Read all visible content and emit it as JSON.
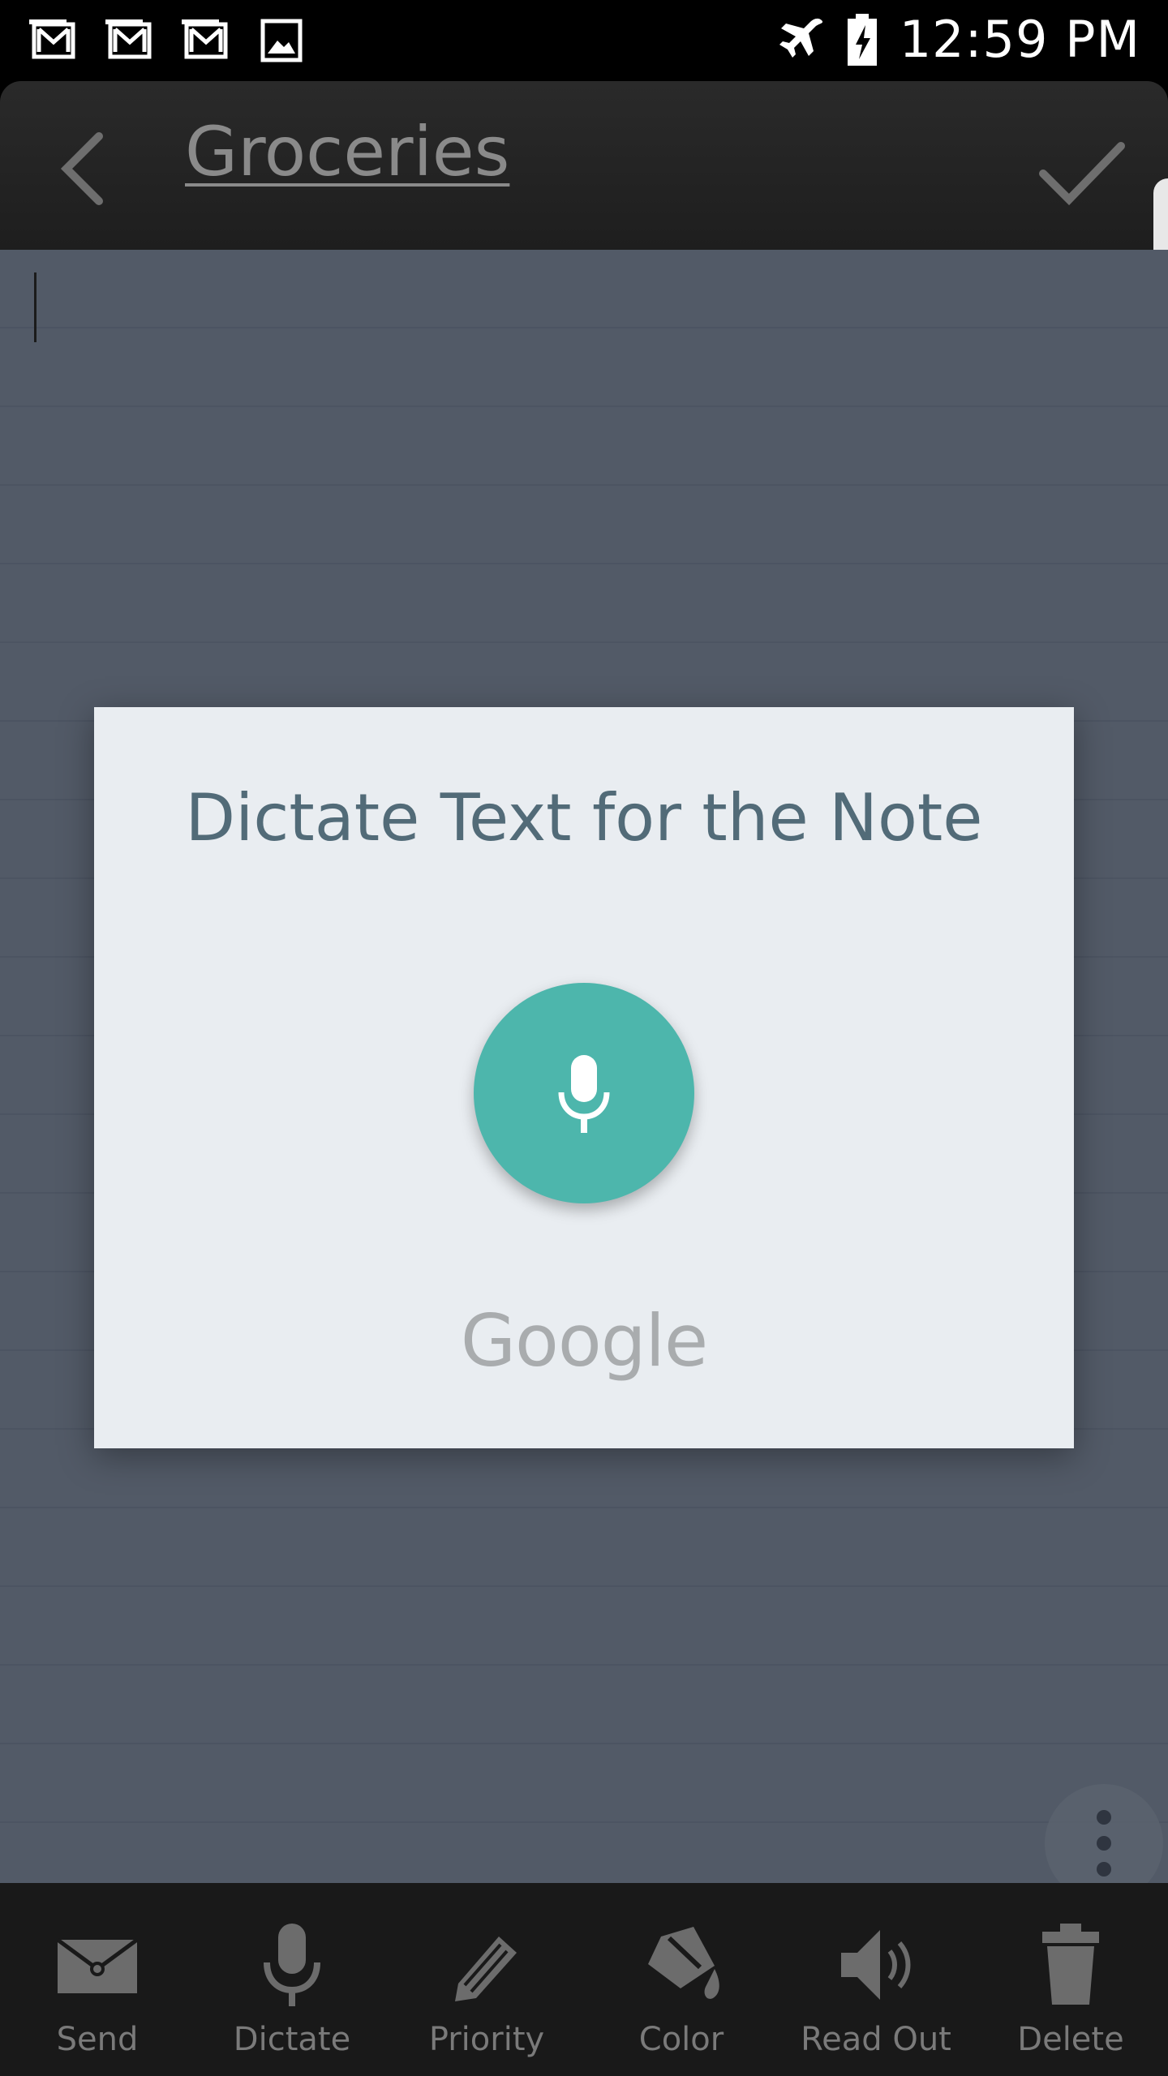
{
  "status_bar": {
    "time": "12:59 PM",
    "left_icons": [
      "gmail-icon",
      "gmail-icon",
      "gmail-icon",
      "gallery-icon"
    ],
    "right_icons": [
      "airplane-mode-icon",
      "battery-charging-icon"
    ]
  },
  "app_bar": {
    "title": "Groceries",
    "back_icon": "chevron-left-icon",
    "confirm_icon": "checkmark-icon"
  },
  "dialog": {
    "title": "Dictate Text for the Note",
    "mic_icon": "microphone-icon",
    "brand": "Google",
    "mic_color": "#4db6ac"
  },
  "more_menu": {
    "icon": "more-vertical-icon"
  },
  "toolbar": {
    "items": [
      {
        "label": "Send",
        "icon": "envelope-icon"
      },
      {
        "label": "Dictate",
        "icon": "microphone-icon"
      },
      {
        "label": "Priority",
        "icon": "pencil-icon"
      },
      {
        "label": "Color",
        "icon": "paint-bucket-icon"
      },
      {
        "label": "Read Out",
        "icon": "speaker-icon"
      },
      {
        "label": "Delete",
        "icon": "trash-icon"
      }
    ]
  },
  "colors": {
    "note_background": "#525a67",
    "app_bar": "#232323",
    "dialog_background": "#e9edf1",
    "dialog_title": "#526b78",
    "toolbar": "#191919"
  }
}
